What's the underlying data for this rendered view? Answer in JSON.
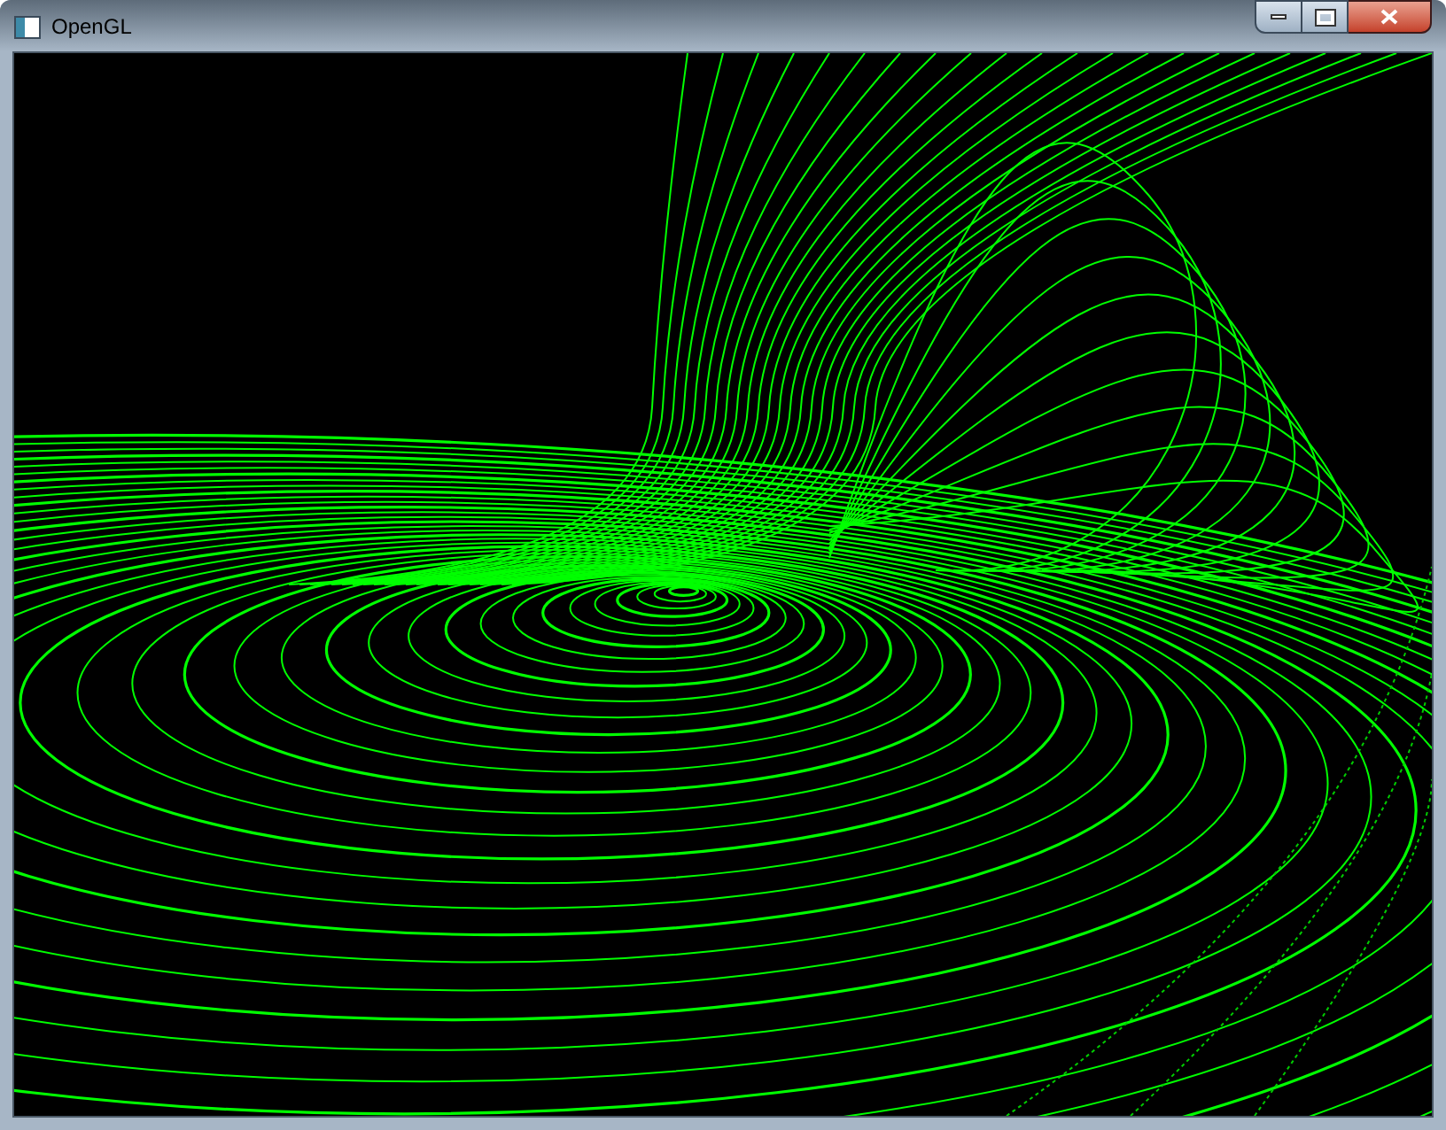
{
  "window": {
    "title": "OpenGL"
  }
}
